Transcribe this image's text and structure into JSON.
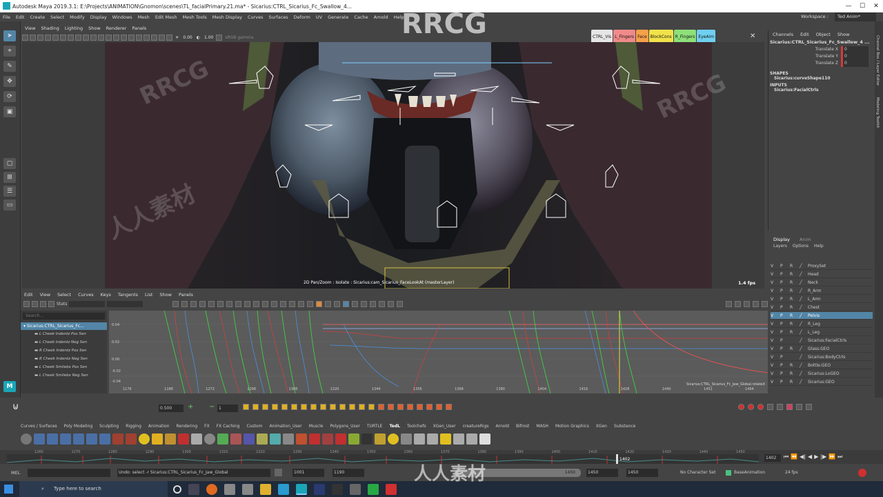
{
  "title_bar": {
    "title": "Autodesk Maya 2019.3.1: E:\\Projects\\ANIMATION\\Gnomon\\scenes\\TL_facialPrimary.21.ma* - Sicarius:CTRL_Sicarius_Fc_Swallow_4...",
    "min": "—",
    "max": "☐",
    "close": "✕"
  },
  "menu": {
    "items": [
      "File",
      "Edit",
      "Create",
      "Select",
      "Modify",
      "Display",
      "Windows",
      "Mesh",
      "Edit Mesh",
      "Mesh Tools",
      "Mesh Display",
      "Curves",
      "Surfaces",
      "Deform",
      "UV",
      "Generate",
      "Cache",
      "Arnold",
      "Help"
    ],
    "workspace_label": "Workspace :",
    "workspace_value": "Ted Anim*"
  },
  "viewport": {
    "menu": [
      "View",
      "Shading",
      "Lighting",
      "Show",
      "Renderer",
      "Panels"
    ],
    "toolbar": {
      "val1": "0.00",
      "val2": "1.00",
      "colorspace": "sRGB gamma"
    },
    "hud_text": "2D Pan/Zoom : Isolate : Sicarius:cam_Sicarius_FaceLookAt (masterLayer)",
    "fps": "1.4 fps"
  },
  "ctrl_tabs": [
    {
      "label": "CTRL_Vis",
      "color": "#e6e6e6"
    },
    {
      "label": "L_Fingers",
      "color": "#f08a8a"
    },
    {
      "label": "Face",
      "color": "#f5a04a"
    },
    {
      "label": "BlockCons",
      "color": "#f2e24a"
    },
    {
      "label": "R_Fingers",
      "color": "#8ee07a"
    },
    {
      "label": "EyeAim",
      "color": "#6fd0f0"
    }
  ],
  "channel_box": {
    "menu": [
      "Channels",
      "Edit",
      "Object",
      "Show"
    ],
    "node": "Sicarius:CTRL_Sicarius_Fc_Swallow_4 ...",
    "channels": [
      {
        "name": "Translate X",
        "value": "0"
      },
      {
        "name": "Translate Y",
        "value": "0"
      },
      {
        "name": "Translate Z",
        "value": "0"
      }
    ],
    "shapes_header": "SHAPES",
    "shape": "Sicarius:curveShape110",
    "inputs_header": "INPUTS",
    "input": "Sicarius:FacialCtrls"
  },
  "side_tabs": [
    "Channel Box / Layer Editor",
    "Modeling Toolkit"
  ],
  "layer_editor": {
    "tabs": [
      "Display",
      "Anim"
    ],
    "menu": [
      "Layers",
      "Options",
      "Help"
    ],
    "layers": [
      {
        "v": "V",
        "p": "P",
        "r": "R",
        "name": "ProxySet",
        "selected": false
      },
      {
        "v": "V",
        "p": "P",
        "r": "R",
        "name": "Head",
        "selected": false
      },
      {
        "v": "V",
        "p": "P",
        "r": "R",
        "name": "Neck",
        "selected": false
      },
      {
        "v": "V",
        "p": "P",
        "r": "R",
        "name": "R_Arm",
        "selected": false
      },
      {
        "v": "V",
        "p": "P",
        "r": "R",
        "name": "L_Arm",
        "selected": false
      },
      {
        "v": "V",
        "p": "P",
        "r": "R",
        "name": "Chest",
        "selected": false
      },
      {
        "v": "V",
        "p": "P",
        "r": "R",
        "name": "Pelvis",
        "selected": true
      },
      {
        "v": "V",
        "p": "P",
        "r": "R",
        "name": "R_Leg",
        "selected": false
      },
      {
        "v": "V",
        "p": "P",
        "r": "R",
        "name": "L_Leg",
        "selected": false
      },
      {
        "v": "V",
        "p": "P",
        "r": "",
        "name": "Sicarius:FacialCtrls",
        "selected": false
      },
      {
        "v": "V",
        "p": "P",
        "r": "R",
        "name": "Glass:GEO",
        "selected": false
      },
      {
        "v": "V",
        "p": "P",
        "r": "",
        "name": "Sicarius:BodyCtrls",
        "selected": false
      },
      {
        "v": "V",
        "p": "P",
        "r": "R",
        "name": "Bottle:GEO",
        "selected": false
      },
      {
        "v": "V",
        "p": "P",
        "r": "R",
        "name": "Sicarius:LoGEO",
        "selected": false
      },
      {
        "v": "V",
        "p": "P",
        "r": "R",
        "name": "Sicarius:GEO",
        "selected": false
      }
    ]
  },
  "graph_editor": {
    "menu": [
      "Edit",
      "View",
      "Select",
      "Curves",
      "Keys",
      "Tangents",
      "List",
      "Show",
      "Panels"
    ],
    "stats_label": "Stats",
    "search_placeholder": "Search...",
    "root_node": "Sicarius:CTRL_Sicarius_Fc...",
    "curves": [
      "L Cheek Indentz Pos Sen",
      "L Cheek Indentz Neg Sen",
      "R Cheek Indentz Pos Sen",
      "R Cheek Indentz Neg Sen",
      "L Cheek Smilebx Pos Sen",
      "L Cheek Smilebx Neg Sen"
    ],
    "y_labels": [
      "0.04",
      "0.02",
      "0.00",
      "-0.02",
      "-0.04"
    ],
    "x_labels": [
      "1176",
      "1188",
      "1272",
      "1296",
      "1308",
      "1320",
      "1344",
      "1356",
      "1368",
      "1380",
      "1404",
      "1416",
      "1428",
      "1440",
      "1452",
      "1464"
    ],
    "status": "Sicarius:CTRL_Sicarius_Fc_Jaw_Global.rotateX"
  },
  "bottom_toolbar": {
    "value1": "0.500",
    "value2": "1"
  },
  "shelf_tabs": [
    "Curves / Surfaces",
    "Poly Modeling",
    "Sculpting",
    "Rigging",
    "Animation",
    "Rendering",
    "FX",
    "FX Caching",
    "Custom",
    "Animation_User",
    "Muscle",
    "Polygons_User",
    "TURTLE",
    "TedL",
    "Toolchefs",
    "XGen_User",
    "creatureRigs",
    "Arnold",
    "Bifrost",
    "MASH",
    "Motion Graphics",
    "XGen",
    "Substance"
  ],
  "time_slider": {
    "ticks": [
      "1260",
      "1270",
      "1280",
      "1290",
      "1300",
      "1310",
      "1320",
      "1330",
      "1340",
      "1350",
      "1360",
      "1370",
      "1380",
      "1390",
      "1400",
      "1410",
      "1420",
      "1430",
      "1440",
      "1450"
    ],
    "current_frame": "1402",
    "frame_field": "1402"
  },
  "range": {
    "start": "1001",
    "inner_start": "1190",
    "inner_end": "1450",
    "end": "1450",
    "end2": "1450",
    "char_set": "No Character Set",
    "anim_layer": "BaseAnimation",
    "fps": "24 fps"
  },
  "command_line": {
    "label": "MEL",
    "result": "Undo: select -r Sicarius:CTRL_Sicarius_Fc_Jaw_Global"
  },
  "taskbar": {
    "search_placeholder": "Type here to search"
  },
  "watermarks": [
    "RRCG",
    "RRCG",
    "RRCG",
    "人人素材",
    "人人素材"
  ]
}
